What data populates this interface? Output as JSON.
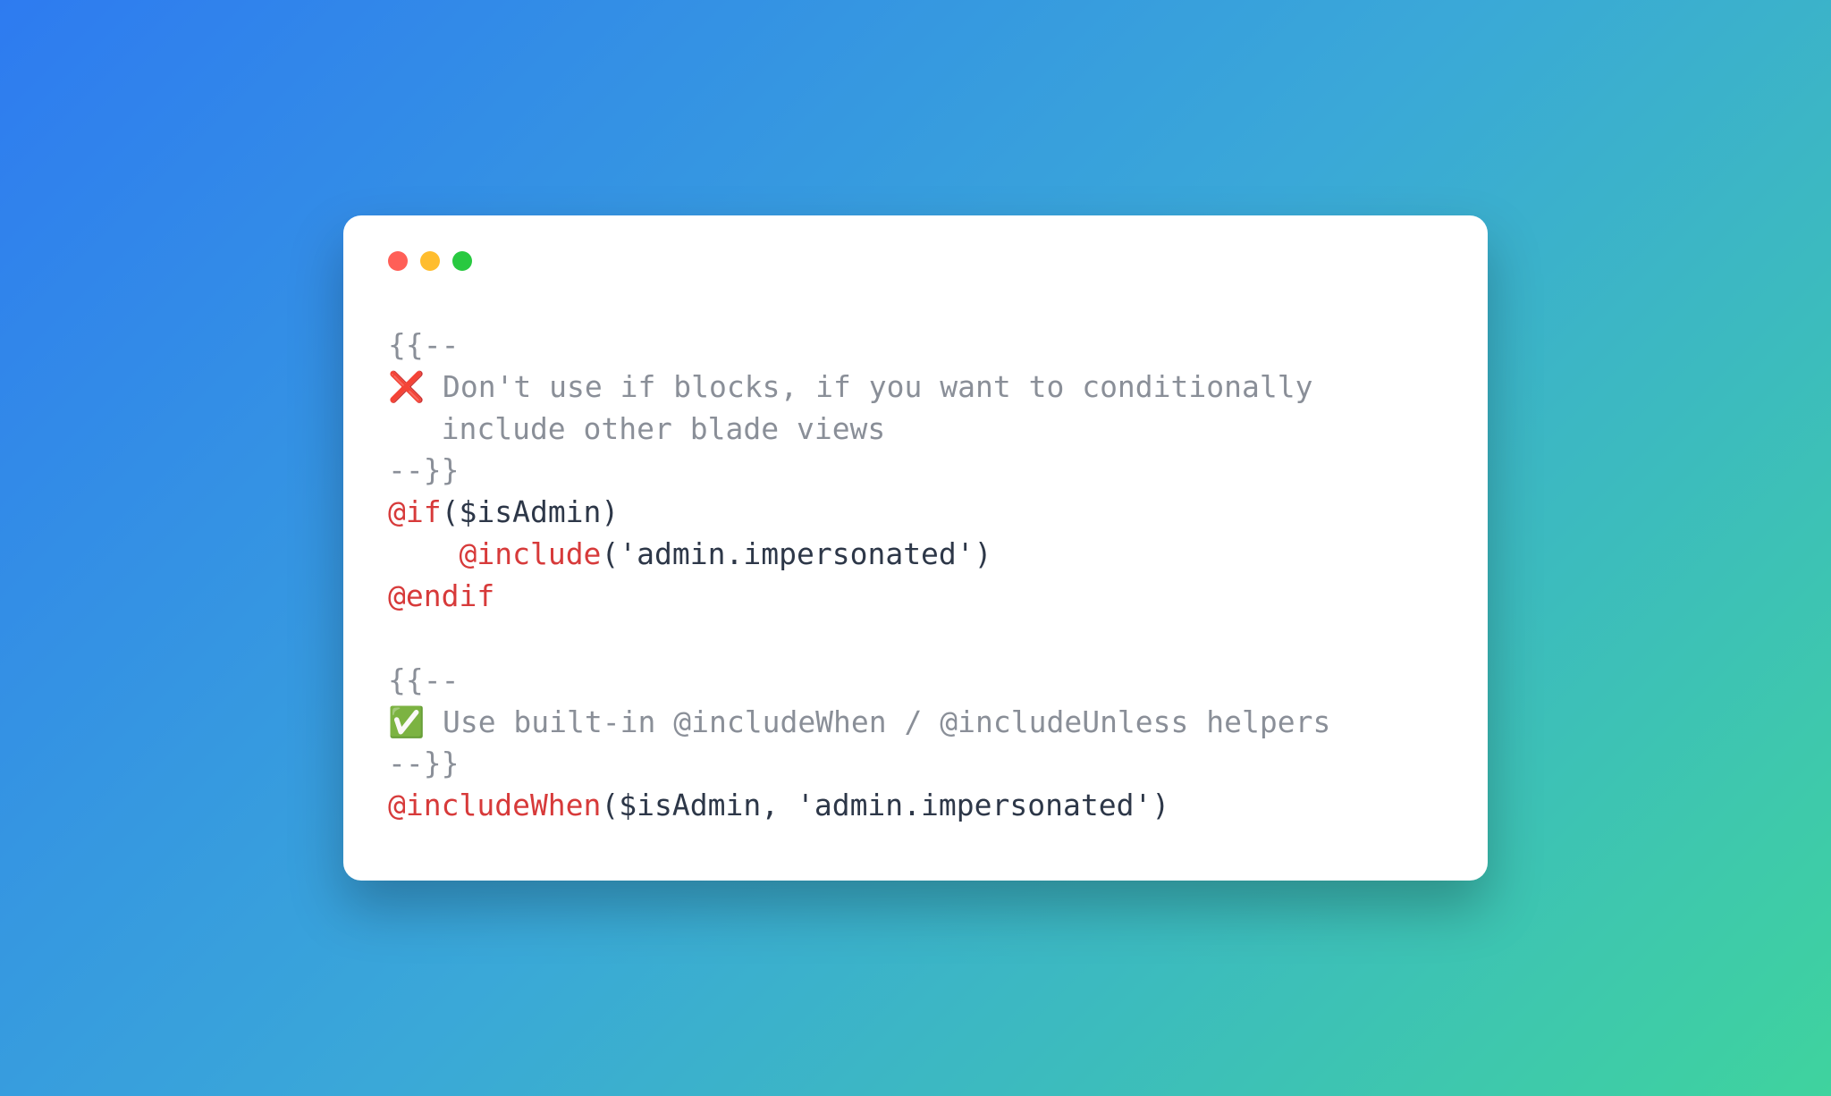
{
  "code": {
    "lines": [
      {
        "segments": [
          {
            "cls": "comment",
            "t": "{{--"
          }
        ]
      },
      {
        "segments": [
          {
            "cls": "emoji",
            "t": "❌"
          },
          {
            "cls": "comment",
            "t": " Don't use if blocks, if you want to conditionally"
          }
        ]
      },
      {
        "segments": [
          {
            "cls": "comment",
            "t": "   include other blade views"
          }
        ]
      },
      {
        "segments": [
          {
            "cls": "comment",
            "t": "--}}"
          }
        ]
      },
      {
        "segments": [
          {
            "cls": "directive",
            "t": "@if"
          },
          {
            "cls": "text",
            "t": "($isAdmin)"
          }
        ]
      },
      {
        "segments": [
          {
            "cls": "text",
            "t": "    "
          },
          {
            "cls": "directive",
            "t": "@include"
          },
          {
            "cls": "text",
            "t": "('admin.impersonated')"
          }
        ]
      },
      {
        "segments": [
          {
            "cls": "directive",
            "t": "@endif"
          }
        ]
      },
      {
        "segments": [
          {
            "cls": "text",
            "t": ""
          }
        ]
      },
      {
        "segments": [
          {
            "cls": "comment",
            "t": "{{--"
          }
        ]
      },
      {
        "segments": [
          {
            "cls": "emoji",
            "t": "✅"
          },
          {
            "cls": "comment",
            "t": " Use built-in @includeWhen / @includeUnless helpers"
          }
        ]
      },
      {
        "segments": [
          {
            "cls": "comment",
            "t": "--}}"
          }
        ]
      },
      {
        "segments": [
          {
            "cls": "directive",
            "t": "@includeWhen"
          },
          {
            "cls": "text",
            "t": "($isAdmin, 'admin.impersonated')"
          }
        ]
      }
    ]
  },
  "colors": {
    "comment": "#8a8f98",
    "directive": "#d73a3a",
    "text": "#2d3748"
  }
}
